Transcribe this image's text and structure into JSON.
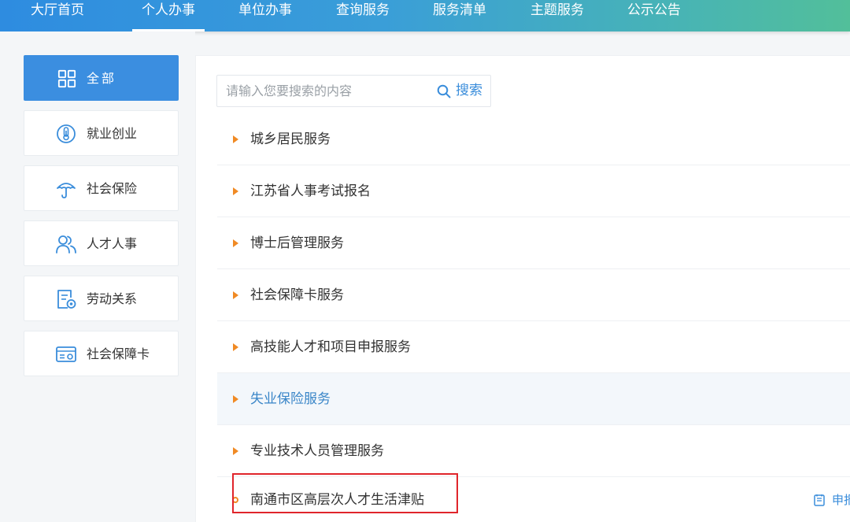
{
  "nav": {
    "items": [
      {
        "label": "大厅首页"
      },
      {
        "label": "个人办事"
      },
      {
        "label": "单位办事"
      },
      {
        "label": "查询服务"
      },
      {
        "label": "服务清单"
      },
      {
        "label": "主题服务"
      },
      {
        "label": "公示公告"
      }
    ],
    "active": "个人办事"
  },
  "sidebar": {
    "items": [
      {
        "label": "全部",
        "icon": "grid-icon",
        "active": true
      },
      {
        "label": "就业创业",
        "icon": "thermometer-icon"
      },
      {
        "label": "社会保险",
        "icon": "umbrella-icon"
      },
      {
        "label": "人才人事",
        "icon": "people-icon"
      },
      {
        "label": "劳动关系",
        "icon": "document-icon"
      },
      {
        "label": "社会保障卡",
        "icon": "card-icon"
      }
    ]
  },
  "search": {
    "placeholder": "请输入您要搜索的内容",
    "button_label": "搜索"
  },
  "categories": [
    {
      "label": "城乡居民服务"
    },
    {
      "label": "江苏省人事考试报名"
    },
    {
      "label": "博士后管理服务"
    },
    {
      "label": "社会保障卡服务"
    },
    {
      "label": "高技能人才和项目申报服务"
    },
    {
      "label": "失业保险服务",
      "highlighted": true
    },
    {
      "label": "专业技术人员管理服务"
    }
  ],
  "sub_item": {
    "label": "南通市区高层次人才生活津贴",
    "action_label": "申报"
  },
  "colors": {
    "accent": "#3b8ee0",
    "arrow": "#f08a24",
    "highlight_box": "#e0252b",
    "nav_gradient_start": "#2e8ce0",
    "nav_gradient_end": "#52bf9a"
  }
}
